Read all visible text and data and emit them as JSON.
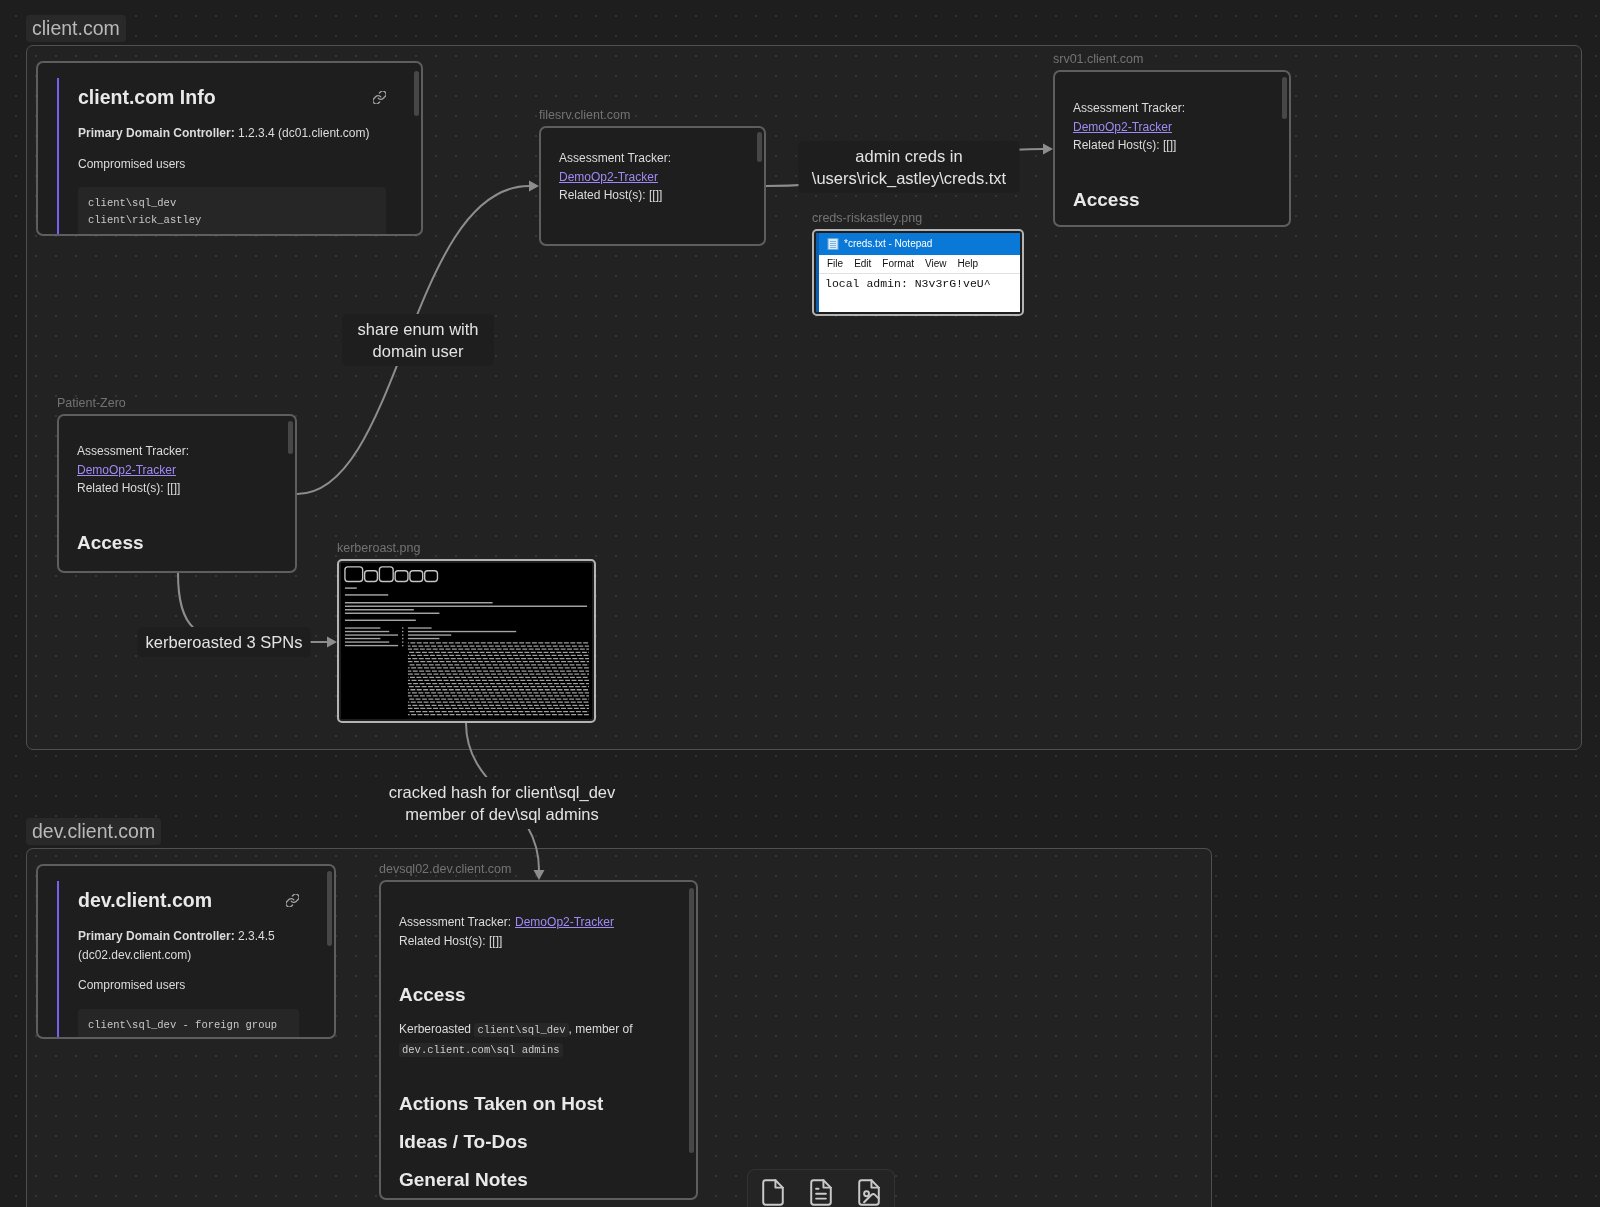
{
  "canvas": {
    "groups": [
      {
        "label": "client.com",
        "nodes": [
          {
            "kind": "info",
            "blocks": [
              {
                "kind": "title",
                "text": "client.com Info"
              },
              {
                "kind": "rich",
                "text": "**Primary Domain Controller:** 1.2.3.4 (dc01.client.com)"
              },
              {
                "kind": "text",
                "text": "Compromised users"
              },
              {
                "kind": "code",
                "lines": [
                  "client\\sql_dev",
                  "client\\rick_astley"
                ]
              }
            ]
          },
          {
            "kind": "note",
            "label": "filesrv.client.com",
            "blocks": [
              {
                "kind": "tracker",
                "label": "Assessment Tracker:",
                "link": "DemoOp2-Tracker"
              },
              {
                "kind": "text",
                "text": "Related Host(s): [[]]"
              }
            ]
          },
          {
            "kind": "note",
            "label": "srv01.client.com",
            "blocks": [
              {
                "kind": "tracker",
                "label": "Assessment Tracker:",
                "link": "DemoOp2-Tracker"
              },
              {
                "kind": "text",
                "text": "Related Host(s): [[]]"
              },
              {
                "kind": "heading",
                "text": "Access"
              }
            ]
          },
          {
            "kind": "image",
            "label": "creds-riskastley.png",
            "picture": {
              "kind": "notepad",
              "title": "*creds.txt - Notepad",
              "menu": [
                "File",
                "Edit",
                "Format",
                "View",
                "Help"
              ],
              "content": "local admin: N3v3rG!veU^"
            }
          },
          {
            "kind": "note",
            "label": "Patient-Zero",
            "blocks": [
              {
                "kind": "tracker",
                "label": "Assessment Tracker:",
                "link": "DemoOp2-Tracker"
              },
              {
                "kind": "text",
                "text": "Related Host(s): [[]]"
              },
              {
                "kind": "heading",
                "text": "Access"
              }
            ]
          },
          {
            "kind": "image",
            "label": "kerberoast.png",
            "picture": {
              "kind": "terminal"
            }
          }
        ]
      },
      {
        "label": "dev.client.com",
        "nodes": [
          {
            "kind": "info",
            "blocks": [
              {
                "kind": "title",
                "text": "dev.client.com"
              },
              {
                "kind": "rich",
                "text": "**Primary Domain Controller:** 2.3.4.5 (dc02.dev.client.com)"
              },
              {
                "kind": "text",
                "text": "Compromised users"
              },
              {
                "kind": "code",
                "lines": [
                  "client\\sql_dev - foreign group"
                ]
              }
            ]
          },
          {
            "kind": "note",
            "label": "devsql02.dev.client.com",
            "blocks": [
              {
                "kind": "tracker",
                "label": "Assessment Tracker:",
                "link": "DemoOp2-Tracker"
              },
              {
                "kind": "text",
                "text": "Related Host(s): [[]]"
              },
              {
                "kind": "heading",
                "text": "Access"
              },
              {
                "kind": "runs",
                "runs": [
                  {
                    "kind": "text",
                    "text": "Kerberoasted "
                  },
                  {
                    "kind": "code",
                    "text": "client\\sql_dev"
                  },
                  {
                    "kind": "text",
                    "text": ", member of "
                  },
                  {
                    "kind": "code",
                    "text": "dev.client.com\\sql admins"
                  }
                ]
              },
              {
                "kind": "heading",
                "text": "Actions Taken on Host"
              },
              {
                "kind": "heading",
                "text": "Ideas / To-Dos"
              },
              {
                "kind": "heading",
                "text": "General Notes"
              }
            ]
          }
        ]
      }
    ],
    "edges": [
      {
        "label": "share enum with domain user"
      },
      {
        "label": "admin creds in \\users\\rick_astley\\creds.txt"
      },
      {
        "label": "kerberoasted 3 SPNs"
      },
      {
        "label": "cracked hash for client\\sql_dev member of dev\\sql admins"
      }
    ]
  }
}
